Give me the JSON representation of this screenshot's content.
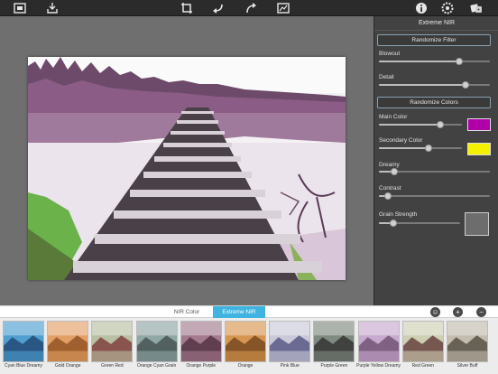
{
  "toolbar": {
    "left_icons": [
      "compare-icon",
      "import-icon"
    ],
    "center_icons": [
      "crop-icon",
      "undo-icon",
      "redo-icon",
      "frame-icon"
    ],
    "right_icons": [
      "info-icon",
      "settings-icon",
      "dice-icon"
    ]
  },
  "panel": {
    "title": "Extreme NIR",
    "randomize_filter": "Randomize Filter",
    "randomize_colors": "Randomize Colors",
    "sliders": {
      "blowout": {
        "label": "Blowout",
        "value": 0.72
      },
      "detail": {
        "label": "Detail",
        "value": 0.78
      },
      "main_color": {
        "label": "Main Color",
        "value": 0.74,
        "color": "#b000a8"
      },
      "secondary_color": {
        "label": "Secondary Color",
        "value": 0.6,
        "color": "#f5f000"
      },
      "dreamy": {
        "label": "Dreamy",
        "value": 0.14
      },
      "contrast": {
        "label": "Contrast",
        "value": 0.08
      },
      "grain_strength": {
        "label": "Grain Strength",
        "value": 0.18
      }
    }
  },
  "tabs": {
    "nir_color": "NIR Color",
    "extreme_nir": "Extreme NIR"
  },
  "filters": [
    {
      "label": "Cyan Blue Dreamy",
      "tone": "#4f9fd0",
      "accent": "#1e3e6a"
    },
    {
      "label": "Gold Orange",
      "tone": "#e3a066",
      "accent": "#8a4a1e"
    },
    {
      "label": "Green Red",
      "tone": "#b9c0a4",
      "accent": "#7a3030"
    },
    {
      "label": "Orange Cyan Grain",
      "tone": "#8fa7a5",
      "accent": "#3e4a48"
    },
    {
      "label": "Orange Purple",
      "tone": "#a47a8f",
      "accent": "#4a2a3a"
    },
    {
      "label": "Orange",
      "tone": "#d7964f",
      "accent": "#6a3f1a"
    },
    {
      "label": "Pink Blue",
      "tone": "#c9c9d9",
      "accent": "#4a4a7a"
    },
    {
      "label": "Purple Green",
      "tone": "#7f8a80",
      "accent": "#2a2a2a"
    },
    {
      "label": "Purple Yellow Dreamy",
      "tone": "#c8a9cf",
      "accent": "#6a4a6a"
    },
    {
      "label": "Red Green",
      "tone": "#cfcfb4",
      "accent": "#5a3030"
    },
    {
      "label": "Silver Buff",
      "tone": "#c4bcae",
      "accent": "#4a4438"
    }
  ]
}
